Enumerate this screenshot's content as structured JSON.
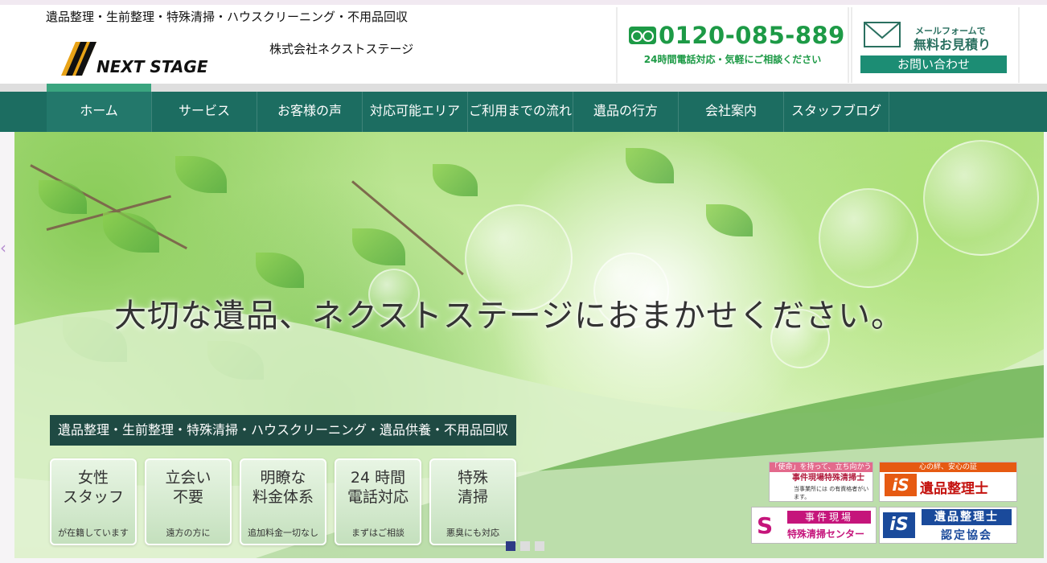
{
  "header": {
    "tagline": "遺品整理・生前整理・特殊清掃・ハウスクリーニング・不用品回収",
    "logo_text": "NEXT STAGE",
    "company": "株式会社ネクストステージ",
    "tel": {
      "icon": "freedial-icon",
      "number": "0120-085-889",
      "note": "24時間電話対応・気軽にご相談ください",
      "color": "#1d9a46"
    },
    "mail": {
      "icon": "envelope-icon",
      "sub": "メールフォームで",
      "main": "無料お見積り",
      "button": "お問い合わせ"
    }
  },
  "nav": {
    "items": [
      {
        "label": "ホーム",
        "active": true
      },
      {
        "label": "サービス"
      },
      {
        "label": "お客様の声"
      },
      {
        "label": "対応可能エリア"
      },
      {
        "label": "ご利用までの流れ"
      },
      {
        "label": "遺品の行方"
      },
      {
        "label": "会社案内"
      },
      {
        "label": "スタッフブログ"
      }
    ],
    "color": "#1c6d61"
  },
  "hero": {
    "title": "大切な遺品、ネクストステージにおまかせください。",
    "subtitle": "遺品整理・生前整理・特殊清掃・ハウスクリーニング・遺品供養・不用品回収",
    "features": [
      {
        "title": "女性\nスタッフ",
        "sub": "が在籍しています"
      },
      {
        "title": "立会い\n不要",
        "sub": "遠方の方に"
      },
      {
        "title": "明瞭な\n料金体系",
        "sub": "追加料金一切なし"
      },
      {
        "title": "24 時間\n電話対応",
        "sub": "まずはご相談"
      },
      {
        "title": "特殊\n清掃",
        "sub": "悪臭にも対応"
      }
    ],
    "slider_active": 1,
    "slider_count": 3
  },
  "badges": {
    "b1": {
      "header": "「使命」を持って、立ち向かう",
      "main": "事件現場特殊清掃士",
      "note": "当事業所には の有資格者がいます。"
    },
    "b2": {
      "header": "心の絆、安心の証",
      "logo": "iS",
      "main": "遺品整理士",
      "note": "当事業所には の有資格者がいます。"
    },
    "b3": {
      "main": "事件現場",
      "sub": "特殊清掃センター"
    },
    "b4": {
      "logo": "iS",
      "main": "遺品整理士",
      "sub": "認定協会"
    }
  }
}
